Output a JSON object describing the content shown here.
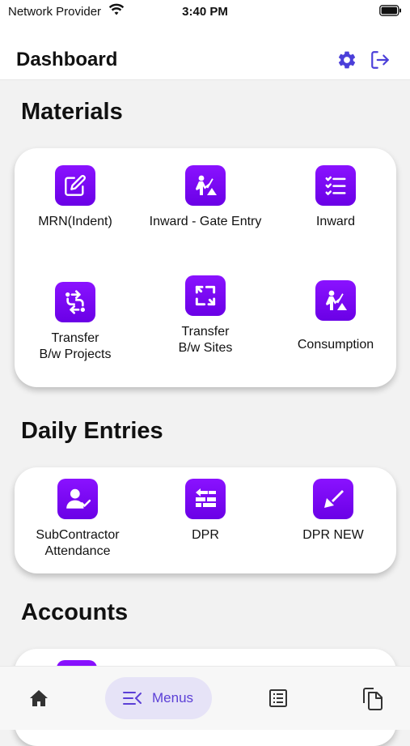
{
  "status_bar": {
    "carrier": "Network Provider",
    "time": "3:40 PM"
  },
  "header": {
    "title": "Dashboard"
  },
  "sections": {
    "materials": {
      "title": "Materials",
      "tiles": [
        {
          "label": "MRN(Indent)",
          "icon": "edit-icon"
        },
        {
          "label": "Inward - Gate Entry",
          "icon": "worker-shovel-icon"
        },
        {
          "label": "Inward",
          "icon": "checklist-icon"
        },
        {
          "label": "Transfer\nB/w  Projects",
          "icon": "transfer-arrows-icon"
        },
        {
          "label": "Transfer\nB/w Sites",
          "icon": "cycle-icon"
        },
        {
          "label": "Consumption",
          "icon": "worker-shovel-icon"
        }
      ]
    },
    "daily_entries": {
      "title": "Daily Entries",
      "tiles": [
        {
          "label": "SubContractor\nAttendance",
          "icon": "user-check-icon"
        },
        {
          "label": "DPR",
          "icon": "bricks-arrow-icon"
        },
        {
          "label": "DPR NEW",
          "icon": "trowel-icon"
        }
      ]
    },
    "accounts": {
      "title": "Accounts"
    }
  },
  "bottom_nav": {
    "menus_label": "Menus"
  },
  "colors": {
    "accent": "#7000ff",
    "nav_active_bg": "#e6e3f7",
    "nav_active_fg": "#5b3fd6",
    "header_icon": "#4b3fd9"
  }
}
